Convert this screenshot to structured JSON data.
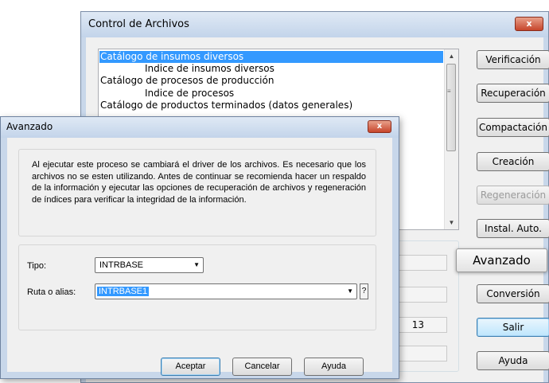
{
  "main_window": {
    "title": "Control de Archivos",
    "close_label": "x",
    "list_items": [
      {
        "label": "Catálogo de insumos diversos",
        "selected": true,
        "indent": false
      },
      {
        "label": "Indice de insumos diversos",
        "selected": false,
        "indent": true
      },
      {
        "label": "Catálogo de procesos de producción",
        "selected": false,
        "indent": false
      },
      {
        "label": "Indice de procesos",
        "selected": false,
        "indent": true
      },
      {
        "label": "Catálogo de productos terminados (datos generales)",
        "selected": false,
        "indent": false
      }
    ],
    "buttons": {
      "verificacion": "Verificación",
      "recuperacion": "Recuperación",
      "compactacion": "Compactación",
      "creacion": "Creación",
      "regeneracion": "Regeneración",
      "instal_auto": "Instal. Auto.",
      "avanzado": "Avanzado",
      "conversion": "Conversión",
      "salir": "Salir",
      "ayuda": "Ayuda"
    },
    "field_value": "13"
  },
  "advanced_dialog": {
    "title": "Avanzado",
    "close_label": "x",
    "message": "Al ejecutar este proceso se cambiará el driver de los archivos. Es necesario que los archivos no se esten utilizando. Antes de continuar se recomienda hacer un respaldo de la información y ejecutar las opciones de recuperación de archivos y regeneración de índices para verificar la integridad de la información.",
    "tipo_label": "Tipo:",
    "tipo_value": "INTRBASE",
    "ruta_label": "Ruta o alias:",
    "ruta_value": "INTRBASE1",
    "help_label": "?",
    "buttons": {
      "aceptar": "Aceptar",
      "cancelar": "Cancelar",
      "ayuda": "Ayuda"
    }
  },
  "colors": {
    "titlebar": "#c8d7ea",
    "selection": "#3399ff",
    "close_button": "#c7452b"
  }
}
